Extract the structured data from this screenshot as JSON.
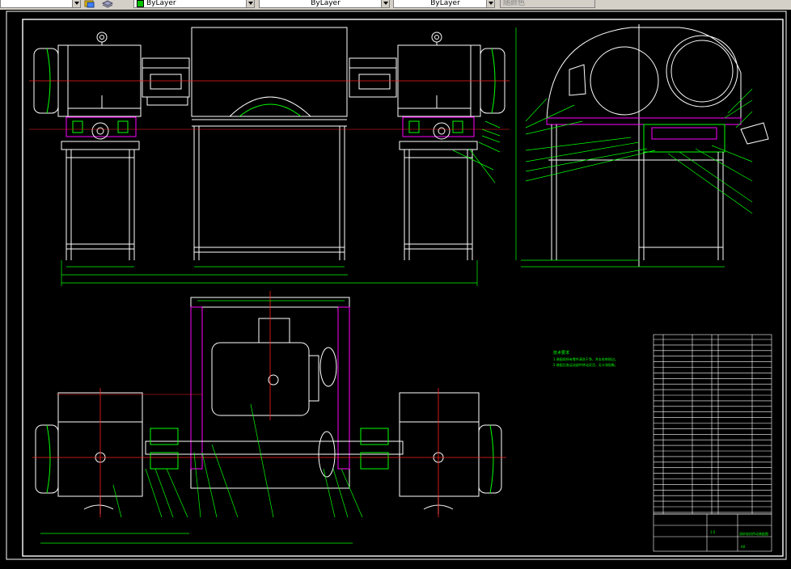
{
  "toolbar": {
    "layer_combo": "ByLayer",
    "linetype_combo": "ByLayer",
    "lineweight_combo": "ByLayer",
    "plotstyle_combo": "随颜色",
    "icons": [
      "layer-manager-icon",
      "layer-stack-icon"
    ]
  },
  "colors": {
    "background": "#000000",
    "line": "#ffffff",
    "dimension": "#00ff00",
    "centerline": "#ff2020",
    "hatch": "#ff00ff",
    "leader": "#00ff00",
    "text": "#00ff00"
  },
  "drawing": {
    "note_title": "技术要求",
    "note_lines": [
      "1.装配前所有零件清洗干净，并去毛刺锐边。",
      "2.装配后各运动部件转动灵活，无卡滞现象。"
    ],
    "title_block": {
      "drawing_name": "双砂轮机传动装配图",
      "scale": "1:5",
      "sheet": "A0"
    }
  }
}
